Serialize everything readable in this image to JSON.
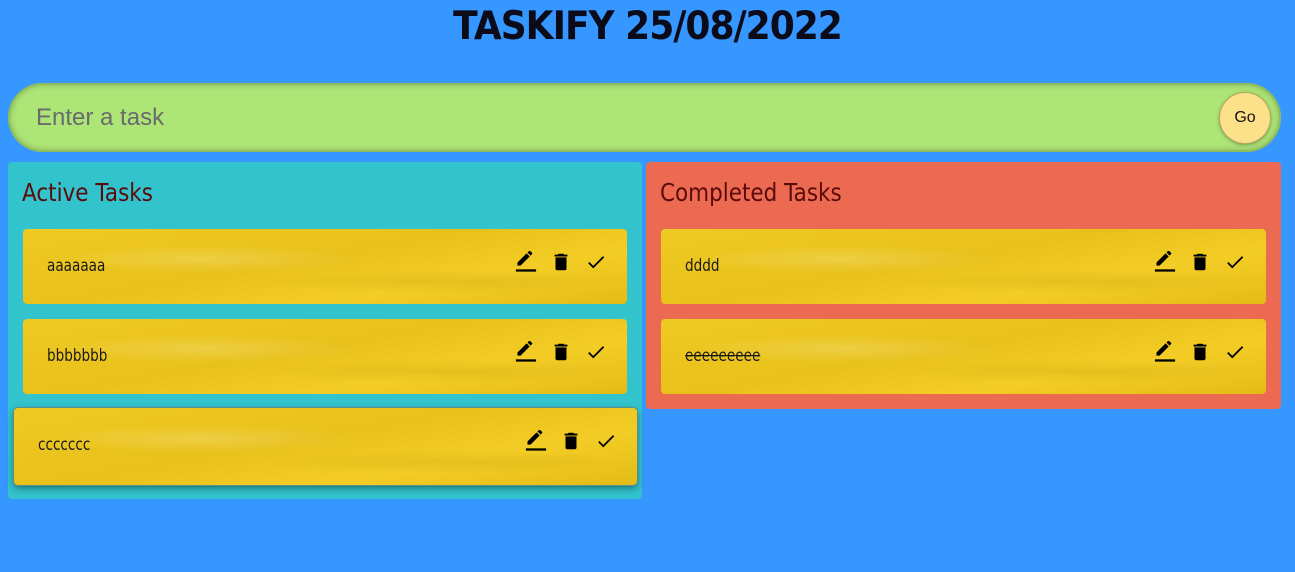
{
  "header": {
    "title": "TASKIFY 25/08/2022"
  },
  "input": {
    "placeholder": "Enter a task",
    "value": "",
    "go_label": "Go"
  },
  "active": {
    "title": "Active Tasks",
    "tasks": [
      {
        "text": "aaaaaaa"
      },
      {
        "text": "bbbbbbb"
      },
      {
        "text": "ccccccc"
      }
    ]
  },
  "completed": {
    "title": "Completed Tasks",
    "tasks": [
      {
        "text": "dddd"
      },
      {
        "text": "eeeeeeeee"
      }
    ]
  },
  "icons": {
    "edit": "edit-icon",
    "delete": "delete-icon",
    "done": "check-icon"
  },
  "colors": {
    "background": "#3597ff",
    "input": "#ade576",
    "go_button": "#fde08a",
    "active_panel": "#32c3cd",
    "completed_panel": "#ec6a52",
    "card": "#ecc61f"
  }
}
